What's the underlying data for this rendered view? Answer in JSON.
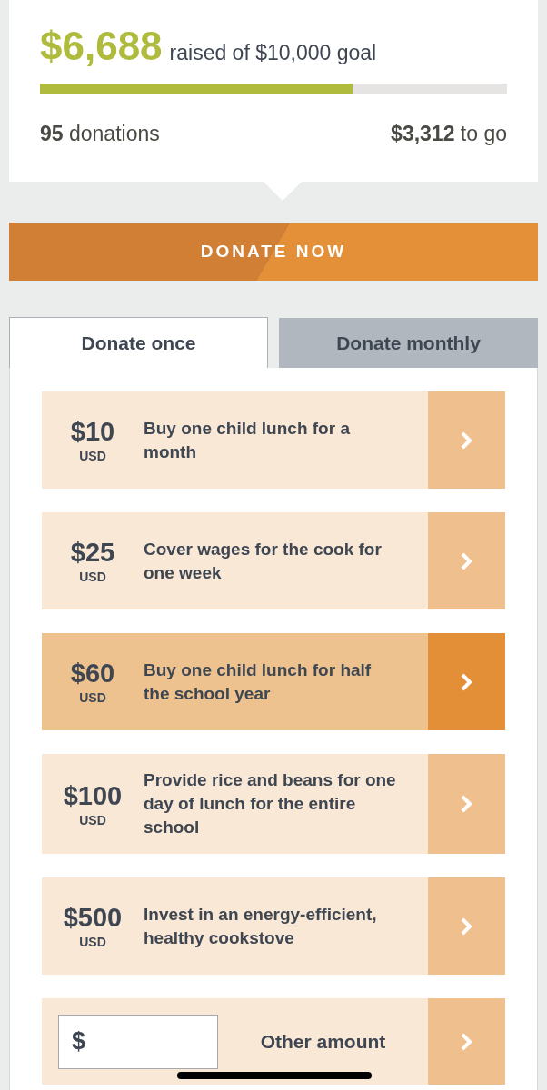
{
  "campaign": {
    "raised": "$6,688",
    "goal_text": "raised of $10,000 goal",
    "level": 0.67,
    "donations_count": "95",
    "donations_label": "donations",
    "remaining": "$3,312",
    "remaining_label": "to go"
  },
  "donate_button": "DONATE NOW",
  "tabs": [
    {
      "label": "Donate once",
      "selected": true
    },
    {
      "label": "Donate monthly",
      "selected": false
    }
  ],
  "options": [
    {
      "amount": "$10",
      "currency": "USD",
      "description": "Buy one child lunch for a month",
      "selected": false
    },
    {
      "amount": "$25",
      "currency": "USD",
      "description": "Cover wages for the cook for one week",
      "selected": false
    },
    {
      "amount": "$60",
      "currency": "USD",
      "description": "Buy one child lunch for half the school year",
      "selected": true
    },
    {
      "amount": "$100",
      "currency": "USD",
      "description": "Provide rice and beans for one day of lunch for the entire school",
      "selected": false
    },
    {
      "amount": "$500",
      "currency": "USD",
      "description": "Invest in an energy-efficient, healthy cookstove",
      "selected": false
    }
  ],
  "other_amount": {
    "prefix": "$",
    "label": "Other amount"
  }
}
